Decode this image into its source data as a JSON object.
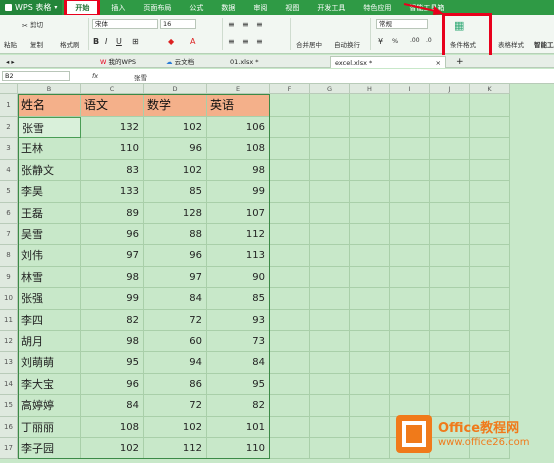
{
  "app": {
    "title": "WPS 表格"
  },
  "menu": [
    "开始",
    "插入",
    "页面布局",
    "公式",
    "数据",
    "审阅",
    "视图",
    "开发工具",
    "特色应用",
    "智能工具箱"
  ],
  "ribbon": {
    "cut": "剪切",
    "paste": "粘贴",
    "copy": "复制",
    "format_painter": "格式刷",
    "font": "宋体",
    "font_size": "16",
    "merge_center": "合并居中",
    "wrap": "自动换行",
    "number_format": "常规",
    "percent": "%",
    "conditional_format": "条件格式",
    "cell_style": "表格样式",
    "smart_toolbox": "智能工具"
  },
  "doc_tabs": [
    "我的WPS",
    "云文档",
    "01.xlsx *",
    "excel.xlsx *"
  ],
  "formula_bar": {
    "cell_ref": "B2",
    "fx": "fx",
    "value": "张雪"
  },
  "columns": [
    "",
    "B",
    "C",
    "D",
    "E",
    "F",
    "G",
    "H",
    "I",
    "J",
    "K"
  ],
  "headers": [
    "姓名",
    "语文",
    "数学",
    "英语"
  ],
  "rows": [
    [
      "张雪",
      "132",
      "102",
      "106"
    ],
    [
      "王林",
      "110",
      "96",
      "108"
    ],
    [
      "张静文",
      "83",
      "102",
      "98"
    ],
    [
      "李昊",
      "133",
      "85",
      "99"
    ],
    [
      "王磊",
      "89",
      "128",
      "107"
    ],
    [
      "吴雪",
      "96",
      "88",
      "112"
    ],
    [
      "刘伟",
      "97",
      "96",
      "113"
    ],
    [
      "林雪",
      "98",
      "97",
      "90"
    ],
    [
      "张强",
      "99",
      "84",
      "85"
    ],
    [
      "李四",
      "82",
      "72",
      "93"
    ],
    [
      "胡月",
      "98",
      "60",
      "73"
    ],
    [
      "刘萌萌",
      "95",
      "94",
      "84"
    ],
    [
      "李大宝",
      "96",
      "86",
      "95"
    ],
    [
      "高婷婷",
      "84",
      "72",
      "82"
    ],
    [
      "丁丽丽",
      "108",
      "102",
      "101"
    ],
    [
      "李子园",
      "102",
      "112",
      "110"
    ]
  ],
  "row_numbers": [
    "1",
    "2",
    "3",
    "4",
    "5",
    "6",
    "7",
    "8",
    "9",
    "10",
    "11",
    "12",
    "13",
    "14",
    "15",
    "16",
    "17"
  ],
  "watermark": {
    "brand": "Office教程网",
    "url": "www.office26.com"
  },
  "colors": {
    "menubar": "#2f9a45",
    "header_fill": "#f4b08a",
    "cell_fill": "#c8e8c9",
    "highlight": "#e8001c",
    "logo_orange": "#f07a1a"
  }
}
